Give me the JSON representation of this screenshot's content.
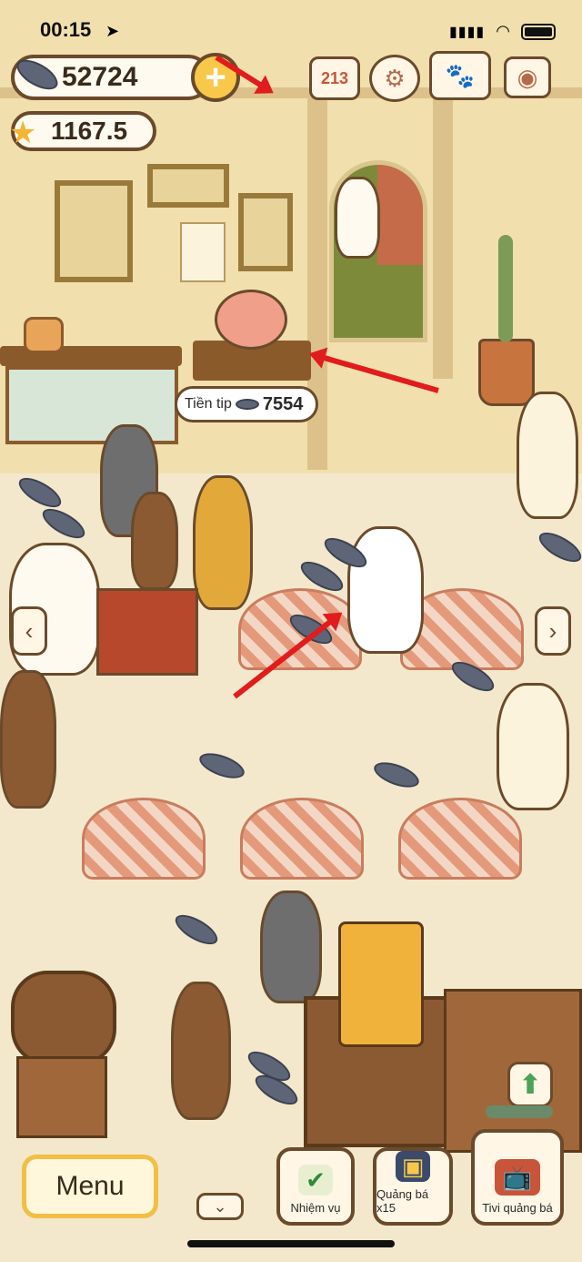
{
  "status_bar": {
    "time": "00:15",
    "signal": "▮▮▮▮",
    "wifi": "wifi",
    "location_icon": "location-arrow-icon"
  },
  "currency": {
    "fish_amount": "52724",
    "star_amount": "1167.5",
    "plus_symbol": "+"
  },
  "top_icons": [
    "ranking-icon",
    "settings-gear-icon",
    "paw-book-icon",
    "camera-icon"
  ],
  "ranking_digits": "213",
  "tip_jar": {
    "label": "Tiền tip",
    "value": "7554"
  },
  "nav": {
    "left_arrow": "‹",
    "right_arrow": "›",
    "down_chevron": "⌄",
    "up_arrow": "⬆"
  },
  "bottom_bar": {
    "menu_label": "Menu",
    "mission_label": "Nhiệm vụ",
    "promote_label": "Quảng bá x15",
    "tv_ad_label": "Tivi quảng bá"
  },
  "colors": {
    "accent_yellow": "#f7c84a",
    "outline_brown": "#6b4a2b",
    "annotation_red": "#e11c1c"
  }
}
